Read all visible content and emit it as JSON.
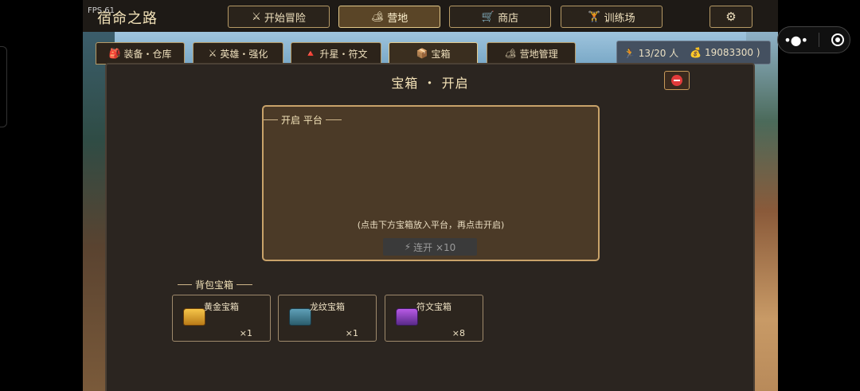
{
  "hud": {
    "fps": "FPS 61"
  },
  "header": {
    "title": "宿命之路",
    "nav": [
      {
        "icon": "⚔",
        "label": "开始冒险",
        "name": "swords-icon"
      },
      {
        "icon": "🏕",
        "label": "营地",
        "name": "camp-icon"
      },
      {
        "icon": "🛒",
        "label": "商店",
        "name": "cart-icon"
      },
      {
        "icon": "🏋",
        "label": "训练场",
        "name": "weightlifter-icon"
      }
    ],
    "settings_icon": "⚙"
  },
  "subtabs": [
    {
      "icon": "🎒",
      "label": "装备・仓库",
      "name": "backpack-icon"
    },
    {
      "icon": "⚔",
      "label": "英雄・强化",
      "name": "swords-icon"
    },
    {
      "icon": "🔺",
      "label": "升星・符文",
      "name": "star-icon"
    },
    {
      "icon": "📦",
      "label": "宝箱",
      "name": "box-icon"
    },
    {
      "icon": "🏕",
      "label": "营地管理",
      "name": "camp-icon"
    }
  ],
  "resources": {
    "people_icon": "🏃",
    "people": "13/20 人",
    "gold_icon": "💰",
    "gold": "19083300 )"
  },
  "panel": {
    "title": "宝箱 ・ 开启",
    "close_icon": "⛔",
    "platform_label": "开启 平台",
    "hint": "(点击下方宝箱放入平台，再点击开启)",
    "multi_icon": "⚡",
    "multi_label": "连开 ×10",
    "bag_label": "背包宝箱",
    "chests": [
      {
        "name": "黄金宝箱",
        "count": "×1"
      },
      {
        "name": "龙纹宝箱",
        "count": "×1"
      },
      {
        "name": "符文宝箱",
        "count": "×8"
      }
    ]
  },
  "colors": {
    "accent": "#e3c98a",
    "panel": "#2b2520",
    "platform": "#4b3a27"
  }
}
